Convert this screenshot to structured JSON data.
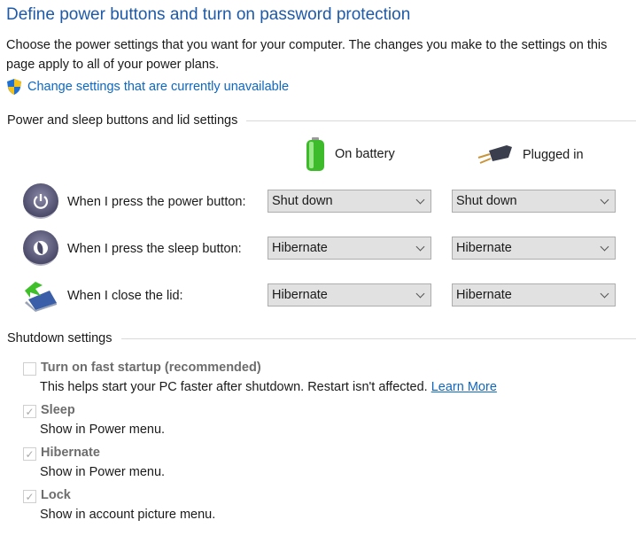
{
  "title": "Define power buttons and turn on password protection",
  "description": "Choose the power settings that you want for your computer. The changes you make to the settings on this page apply to all of your power plans.",
  "change_link": "Change settings that are currently unavailable",
  "power_section": {
    "heading": "Power and sleep buttons and lid settings",
    "columns": [
      "On battery",
      "Plugged in"
    ],
    "rows": [
      {
        "label": "When I press the power button:",
        "battery": "Shut down",
        "plugged": "Shut down"
      },
      {
        "label": "When I press the sleep button:",
        "battery": "Hibernate",
        "plugged": "Hibernate"
      },
      {
        "label": "When I close the lid:",
        "battery": "Hibernate",
        "plugged": "Hibernate"
      }
    ]
  },
  "shutdown_section": {
    "heading": "Shutdown settings",
    "items": [
      {
        "label": "Turn on fast startup (recommended)",
        "desc": "This helps start your PC faster after shutdown. Restart isn't affected.",
        "link": "Learn More",
        "checked": false
      },
      {
        "label": "Sleep",
        "desc": "Show in Power menu.",
        "checked": true
      },
      {
        "label": "Hibernate",
        "desc": "Show in Power menu.",
        "checked": true
      },
      {
        "label": "Lock",
        "desc": "Show in account picture menu.",
        "checked": true
      }
    ]
  }
}
